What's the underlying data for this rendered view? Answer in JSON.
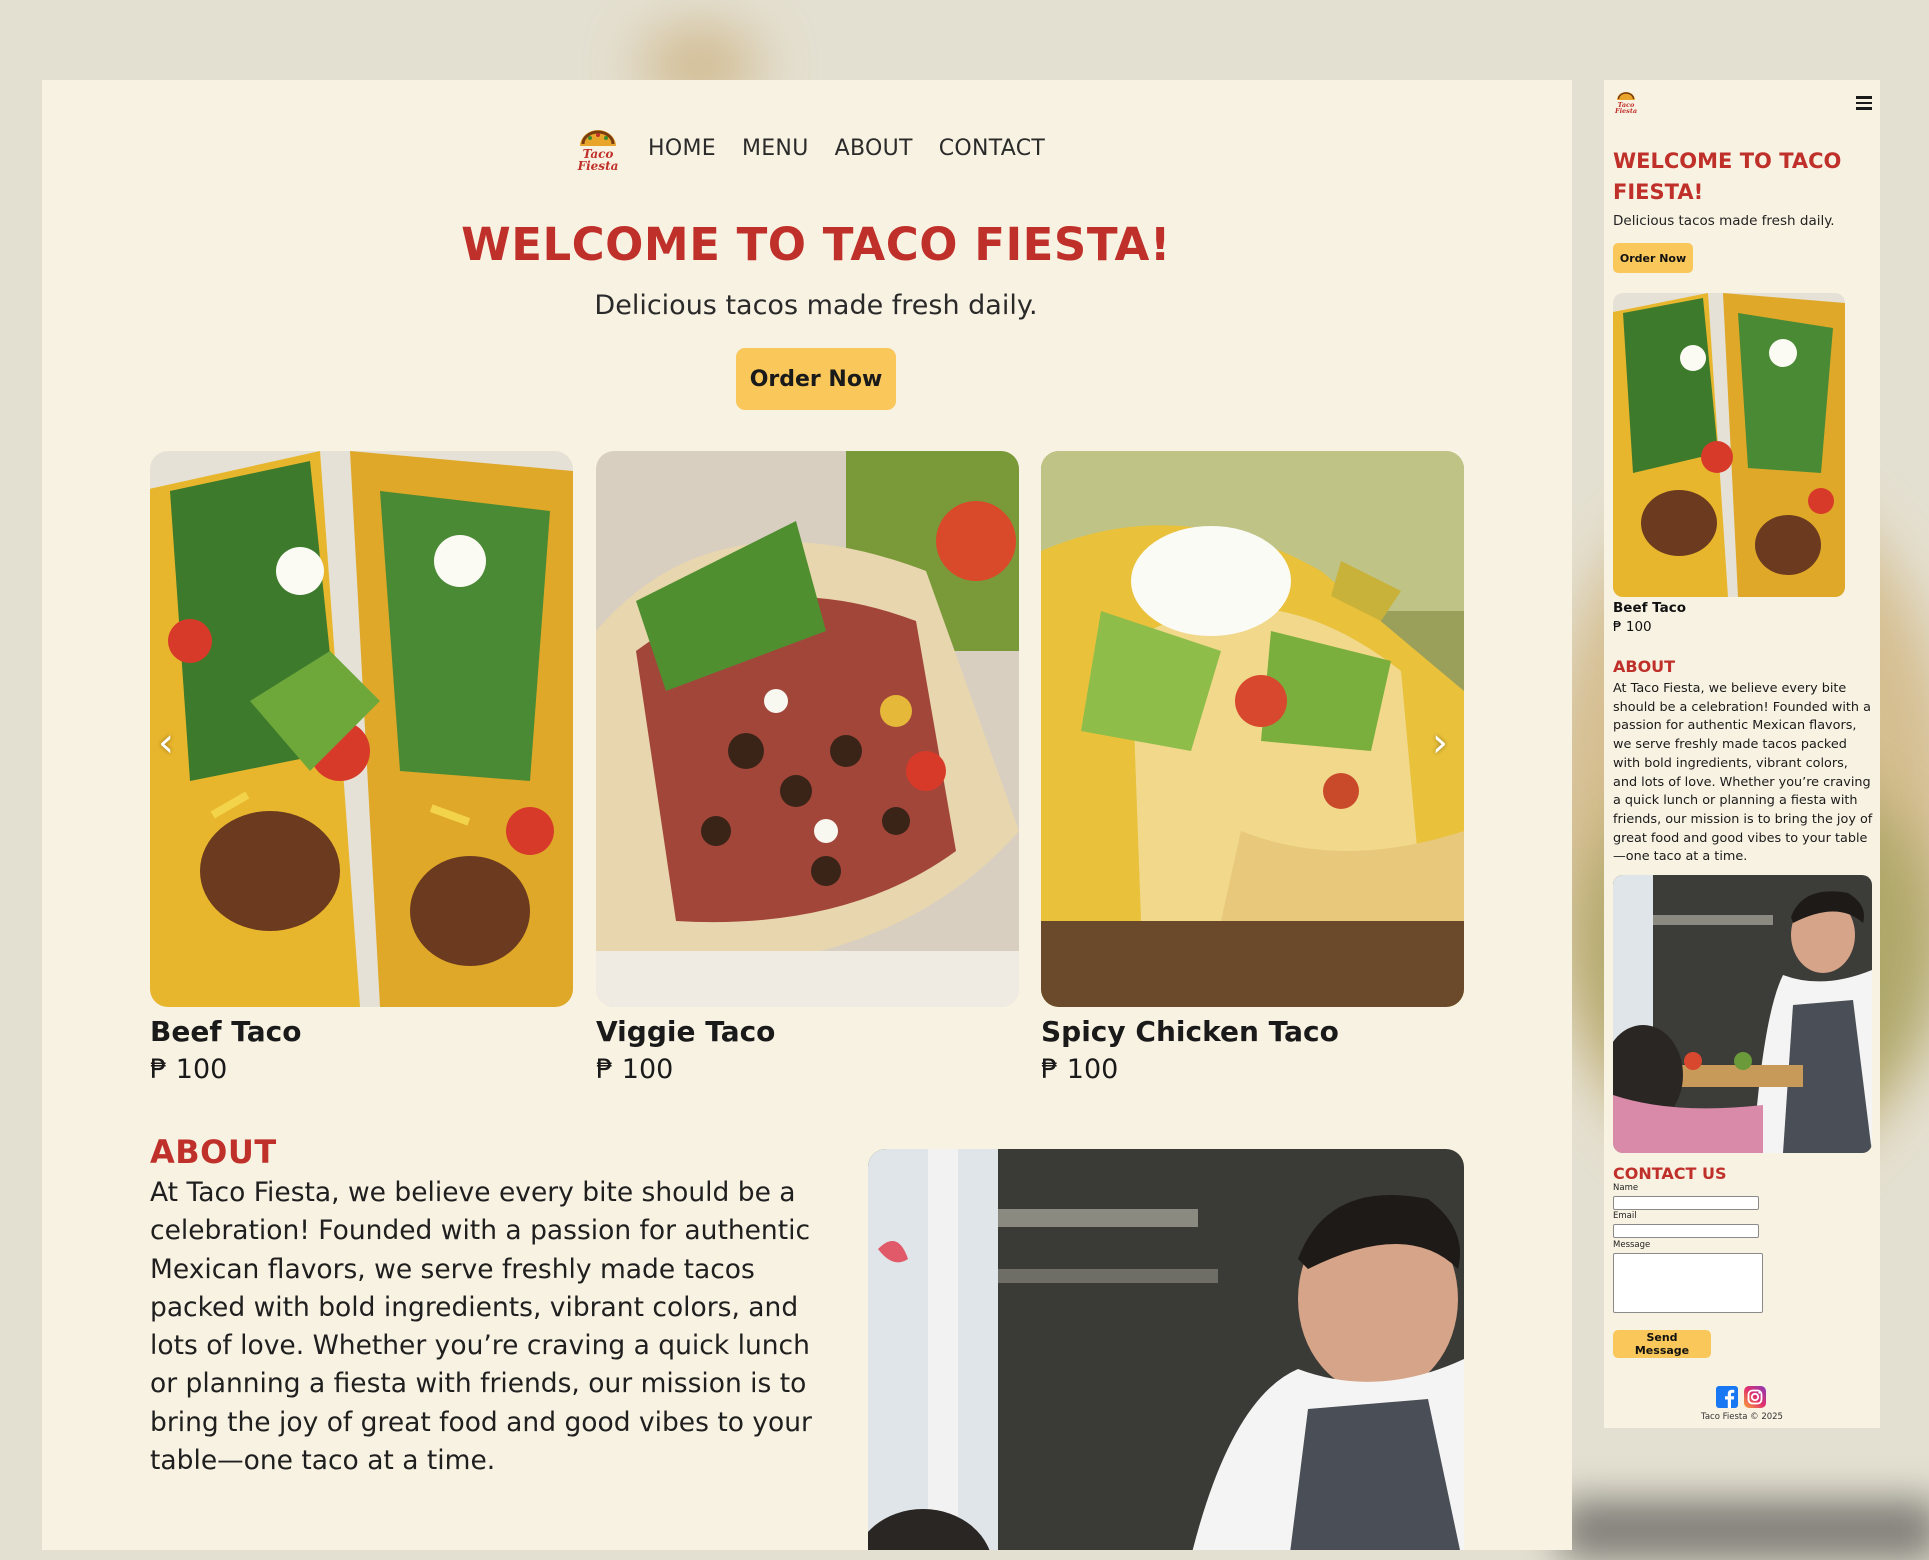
{
  "brand": {
    "logo_text_top": "Taco",
    "logo_text_bottom": "Fiesta"
  },
  "nav": {
    "items": [
      "HOME",
      "MENU",
      "ABOUT",
      "CONTACT"
    ]
  },
  "hero": {
    "title": "WELCOME TO TACO FIESTA!",
    "subtitle": "Delicious tacos made fresh daily.",
    "cta": "Order Now"
  },
  "menu": {
    "items": [
      {
        "name": "Beef Taco",
        "price": "₱ 100"
      },
      {
        "name": "Viggie Taco",
        "price": "₱ 100"
      },
      {
        "name": "Spicy Chicken Taco",
        "price": "₱ 100"
      }
    ],
    "prev_arrow": "‹",
    "next_arrow": "›"
  },
  "about": {
    "heading": "ABOUT",
    "body": "At Taco Fiesta, we believe every bite should be a celebration! Founded with a passion for authentic Mexican flavors, we serve freshly made tacos packed with bold ingredients, vibrant colors, and lots of love. Whether you’re craving a quick lunch or planning a fiesta with friends, our mission is to bring the joy of great food and good vibes to your table—one taco at a time."
  },
  "mobile": {
    "title": "WELCOME TO TACO FIESTA!",
    "subtitle": "Delicious tacos made fresh daily.",
    "cta": "Order Now",
    "card": {
      "name": "Beef Taco",
      "price": "₱ 100"
    },
    "about_heading": "ABOUT",
    "contact": {
      "heading": "CONTACT US",
      "name_label": "Name",
      "email_label": "Email",
      "message_label": "Message",
      "send": "Send Message"
    },
    "footer": "Taco Fiesta © 2025"
  },
  "colors": {
    "accent_red": "#c0302a",
    "button_yellow": "#f9c75a",
    "page_bg": "#f8f2e2",
    "facebook": "#1877f2"
  },
  "icons": [
    "hamburger-menu-icon",
    "facebook-icon",
    "instagram-icon",
    "chevron-left-icon",
    "chevron-right-icon"
  ]
}
